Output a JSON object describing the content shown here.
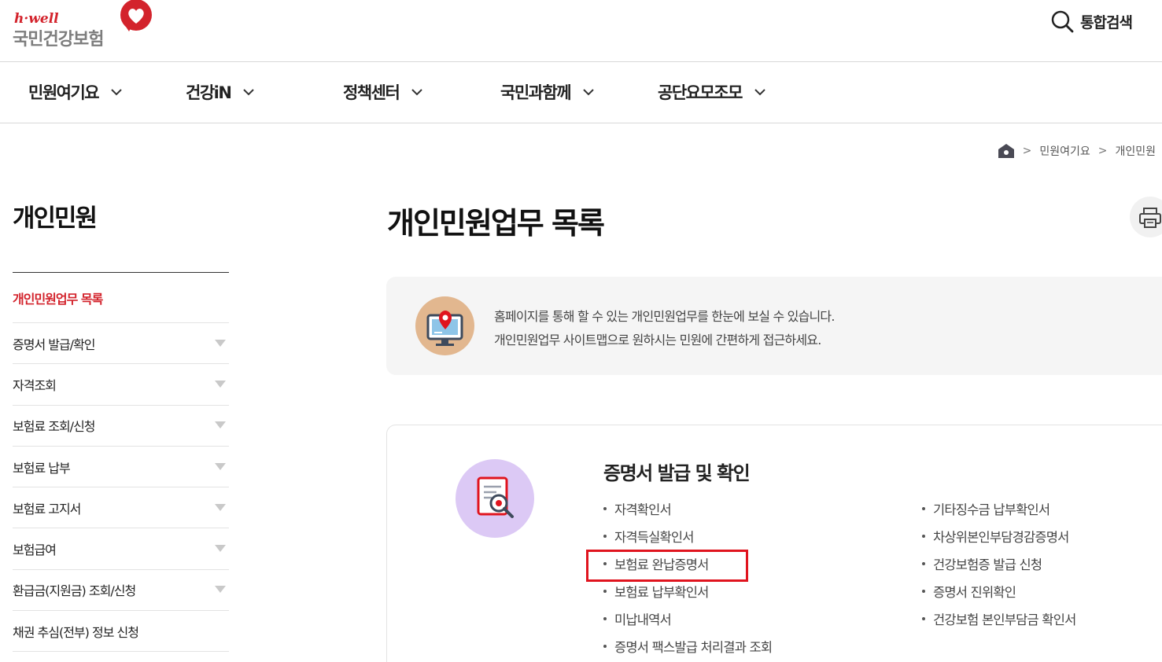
{
  "header": {
    "logo_small": "h·well",
    "logo_main": "국민건강보험",
    "search_label": "통합검색"
  },
  "gnb": {
    "items": [
      {
        "label": "민원여기요"
      },
      {
        "label": "건강iN"
      },
      {
        "label": "정책센터"
      },
      {
        "label": "국민과함께"
      },
      {
        "label": "공단요모조모"
      }
    ]
  },
  "breadcrumb": {
    "items": [
      "민원여기요",
      "개인민원"
    ],
    "separator": ">"
  },
  "sidebar": {
    "title": "개인민원",
    "items": [
      {
        "label": "개인민원업무 목록",
        "active": true,
        "expandable": false
      },
      {
        "label": "증명서 발급/확인",
        "expandable": true
      },
      {
        "label": "자격조회",
        "expandable": true
      },
      {
        "label": "보험료 조회/신청",
        "expandable": true
      },
      {
        "label": "보험료 납부",
        "expandable": true
      },
      {
        "label": "보험료 고지서",
        "expandable": true
      },
      {
        "label": "보험급여",
        "expandable": true
      },
      {
        "label": "환급금(지원금) 조회/신청",
        "expandable": true
      },
      {
        "label": "채권 추심(전부) 정보 신청",
        "expandable": false
      }
    ]
  },
  "main": {
    "title": "개인민원업무 목록",
    "info": {
      "line1": "홈페이지를 통해 할 수 있는 개인민원업무를 한눈에 보실 수 있습니다.",
      "line2": "개인민원업무 사이트맵으로 원하시는 민원에 간편하게 접근하세요."
    },
    "section": {
      "title": "증명서 발급 및 확인",
      "col1": [
        "자격확인서",
        "자격득실확인서",
        "보험료 완납증명서",
        "보험료 납부확인서",
        "미납내역서",
        "증명서 팩스발급 처리결과 조회"
      ],
      "col2": [
        "기타징수금 납부확인서",
        "차상위본인부담경감증명서",
        "건강보험증 발급 신청",
        "증명서 진위확인",
        "건강보험 본인부담금 확인서"
      ],
      "highlighted_item": "보험료 완납증명서"
    }
  },
  "colors": {
    "brand_red": "#d3232c",
    "highlight_box": "#e0141e",
    "info_icon_bg": "#e2b78f",
    "card_icon_bg": "#dcc9f5"
  },
  "icons": [
    "heart-logo-icon",
    "search-icon",
    "chevron-down-icon",
    "home-icon",
    "print-icon",
    "monitor-location-icon",
    "document-search-icon"
  ]
}
